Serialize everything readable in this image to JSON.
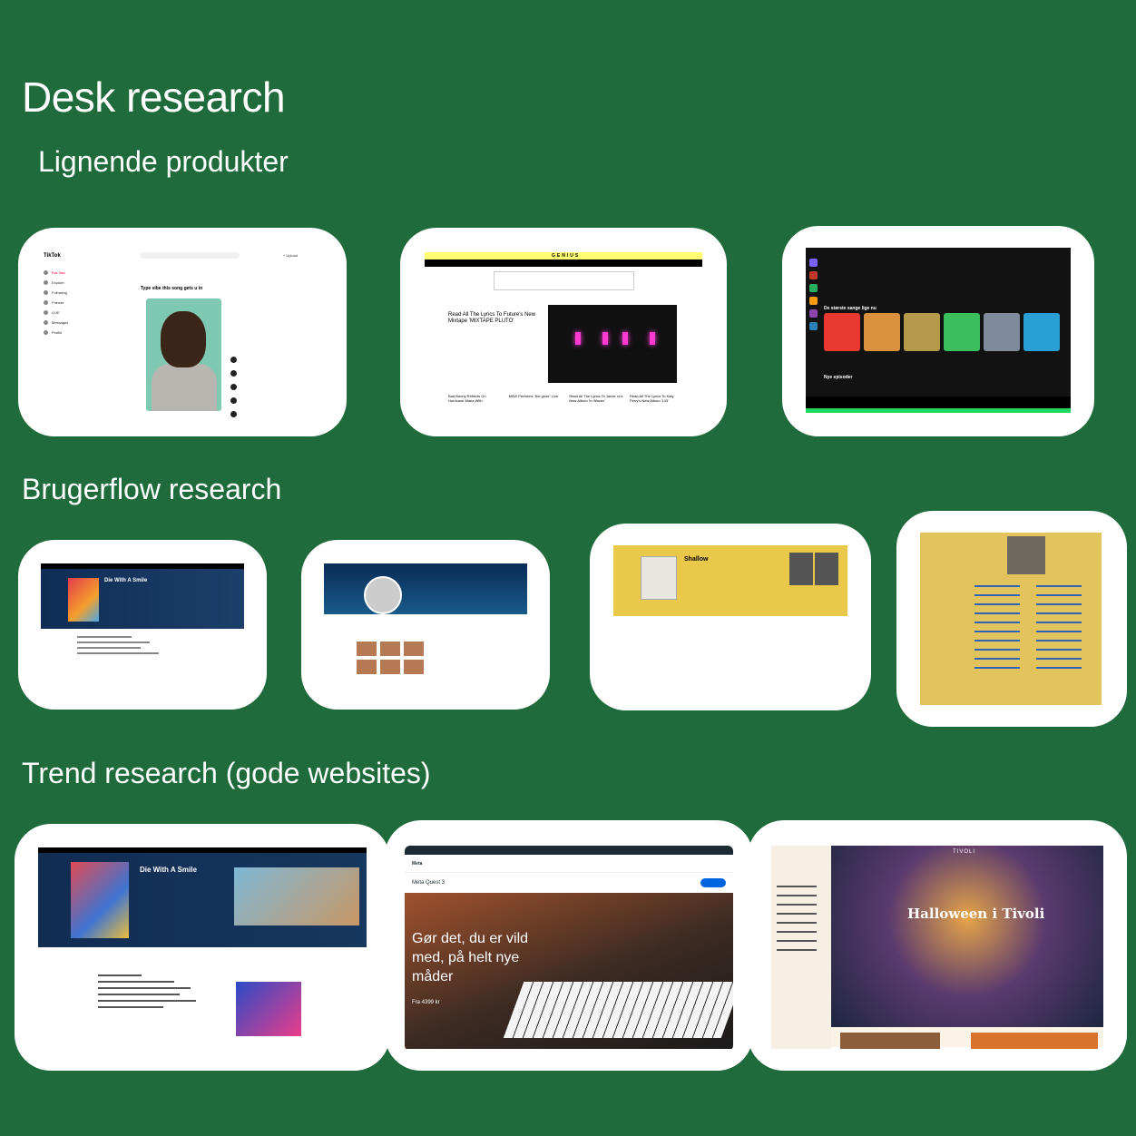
{
  "headings": {
    "main": "Desk research",
    "similar": "Lignende produkter",
    "userflow": "Brugerflow research",
    "trend": "Trend research (gode websites)"
  },
  "tiktok": {
    "logo": "TikTok",
    "upload": "+ Upload",
    "nav": [
      "For You",
      "Explore",
      "Following",
      "Friends",
      "LIVE",
      "Messages",
      "Profile"
    ],
    "caption": "Type vibe this song gets u in"
  },
  "genius": {
    "logo": "GENIUS",
    "headline": "Read All The Lyrics To Future's New Mixtape 'MIXTAPE PLUTO'",
    "articles": [
      "Bad Bunny Reflects On Hurricane Maria With",
      "MAVI Performs \"the giver\" Live",
      "Read All The Lyrics To Jamie xx's New Album 'In Waves'",
      "Read All The Lyrics To Katy Perry's New Album '143'"
    ]
  },
  "spotify": {
    "section_songs": "De største sange lige nu",
    "section_episodes": "Nye episoder"
  },
  "flow": {
    "song1": "Die With A Smile",
    "song2": "Shallow"
  },
  "trend": {
    "genius_song": "Die With A Smile",
    "meta_logo": "Meta",
    "meta_product": "Meta Quest 3",
    "meta_hero": "Gør det, du er vild med, på helt nye måder",
    "meta_price_label": "Fra",
    "meta_price": "4399 kr",
    "tivoli_hero": "Halloween i Tivoli",
    "tivoli_logo": "TIVOLI"
  },
  "colors": {
    "background": "#1f6b3c",
    "card": "#ffffff"
  }
}
